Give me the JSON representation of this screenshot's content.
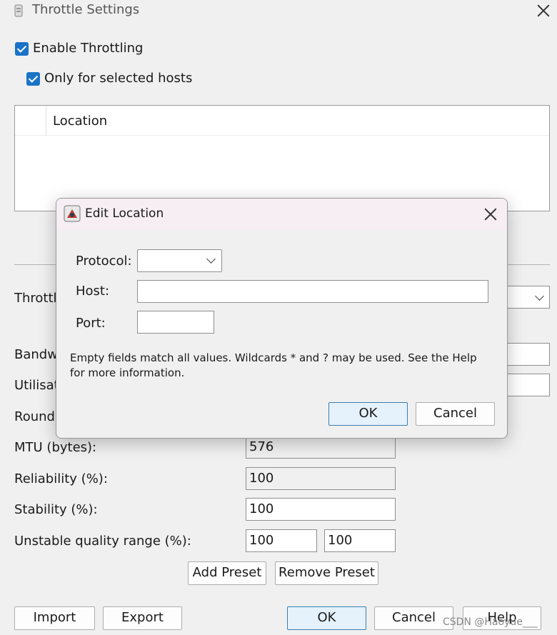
{
  "window": {
    "title": "Throttle Settings",
    "enable_throttling": {
      "label": "Enable Throttling",
      "checked": true
    },
    "only_selected_hosts": {
      "label": "Only for selected hosts",
      "checked": true
    },
    "hosts_table": {
      "columns": [
        "",
        "Location"
      ],
      "rows": []
    },
    "partial_labels": {
      "throttle": "Throttl",
      "bandwidth": "Bandw",
      "utilisation": "Utilisat",
      "round": "Round"
    },
    "fields": {
      "mtu": {
        "label": "MTU (bytes):",
        "value": "576"
      },
      "reliability": {
        "label": "Reliability (%):",
        "value": "100"
      },
      "stability": {
        "label": "Stability (%):",
        "value": "100"
      },
      "unstable_range": {
        "label": "Unstable quality range (%):",
        "value_min": "100",
        "value_max": "100"
      }
    },
    "buttons": {
      "add_preset": "Add Preset",
      "remove_preset": "Remove Preset",
      "import": "Import",
      "export": "Export",
      "ok": "OK",
      "cancel": "Cancel",
      "help": "Help"
    }
  },
  "dialog": {
    "title": "Edit Location",
    "protocol": {
      "label": "Protocol:",
      "value": ""
    },
    "host": {
      "label": "Host:",
      "value": ""
    },
    "port": {
      "label": "Port:",
      "value": ""
    },
    "info": "Empty fields match all values. Wildcards * and ? may be used. See the Help for more information.",
    "ok": "OK",
    "cancel": "Cancel"
  },
  "watermark": "CSDN @Haoyue___",
  "colors": {
    "accent": "#1a73c7",
    "primary_button_bg": "#e5f1fb",
    "primary_button_border": "#3c7fb1",
    "dialog_title_bg": "#f6eef3"
  },
  "icons": {
    "app": "app-icon",
    "close": "close-icon",
    "dropdown": "chevron-down-icon",
    "dialog": "java-icon"
  }
}
